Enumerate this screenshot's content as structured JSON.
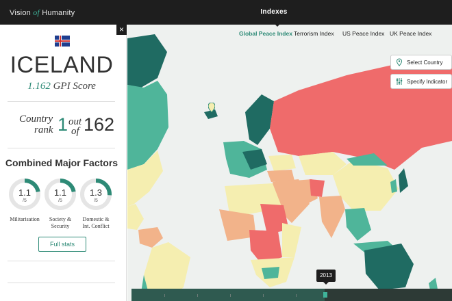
{
  "header": {
    "brand_vision": "Vision",
    "brand_of": "of",
    "brand_humanity": "Humanity",
    "title": "Indexes"
  },
  "sidebar": {
    "close_label": "×",
    "country": "ICELAND",
    "gpi_score": "1.162",
    "gpi_label": "GPI Score",
    "rank_country": "Country",
    "rank_word": "rank",
    "rank_value": "1",
    "rank_out": "out",
    "rank_of": "of",
    "rank_total": "162",
    "factors_title": "Combined Major Factors",
    "factors": [
      {
        "value": "1.1",
        "denominator": "/5",
        "label_line1": "Militarisation",
        "label_line2": "",
        "fraction": 0.22
      },
      {
        "value": "1.1",
        "denominator": "/5",
        "label_line1": "Society &",
        "label_line2": "Security",
        "fraction": 0.22
      },
      {
        "value": "1.3",
        "denominator": "/5",
        "label_line1": "Domestic &",
        "label_line2": "Int. Conflict",
        "fraction": 0.26
      }
    ],
    "full_stats": "Full stats"
  },
  "tabs": [
    {
      "label": "Global Peace Index",
      "active": true
    },
    {
      "label": "Terrorism Index",
      "active": false
    },
    {
      "label": "US Peace Index",
      "active": false
    },
    {
      "label": "UK Peace Index",
      "active": false
    }
  ],
  "map_controls": {
    "select_country": "Select Country",
    "specify_indicator": "Specify Indicator"
  },
  "timeline": {
    "year": "2013"
  },
  "colors": {
    "accent": "#2d8a76",
    "very_high": "#1f6b62",
    "high": "#4fb59a",
    "medium": "#f5eeb0",
    "low": "#f2b38a",
    "very_low": "#ef6b6b"
  }
}
